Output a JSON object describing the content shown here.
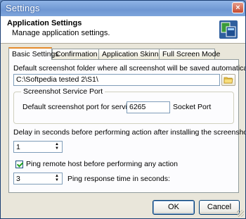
{
  "window": {
    "title": "Settings",
    "close_glyph": "×"
  },
  "header": {
    "title": "Application Settings",
    "subtitle": "Manage application settings.",
    "icon": "settings-app-icon"
  },
  "tabs": [
    {
      "label": "Basic Settings",
      "active": true
    },
    {
      "label": "Confirmation",
      "active": false
    },
    {
      "label": "Application Skinning",
      "active": false
    },
    {
      "label": "Full Screen Mode",
      "active": false
    }
  ],
  "basic": {
    "folder_label": "Default screenshot folder where all screenshot will be saved automatically.",
    "folder_value": "C:\\Softpedia tested 2\\S1\\",
    "folder_button_icon": "folder-icon",
    "port_group_title": "Screenshot Service Port",
    "port_label": "Default screenshot port for service:",
    "port_value": "6265",
    "port_suffix": "Socket Port",
    "delay_label": "Delay in seconds before performing action after installing the screenshot service",
    "delay_value": "1",
    "ping_label": "Ping remote host before performing any action",
    "ping_checked": true,
    "ping_value": "3",
    "ping_time_label": "Ping response time in seconds:"
  },
  "buttons": {
    "ok": "OK",
    "cancel": "Cancel"
  }
}
